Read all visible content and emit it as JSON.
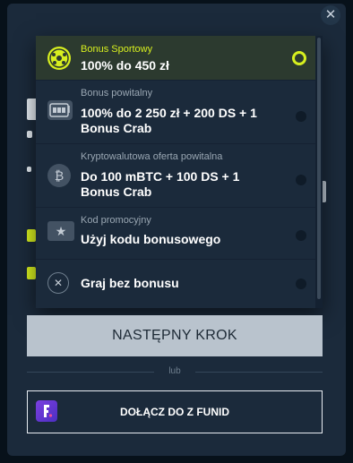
{
  "modal": {
    "close_icon": "close-icon",
    "options": [
      {
        "subtitle": "Bonus Sportowy",
        "title": "100% do 450 zł",
        "icon": "football-icon",
        "selected": true
      },
      {
        "subtitle": "Bonus powitalny",
        "title": "100% do 2 250 zł + 200 DS + 1 Bonus Crab",
        "icon": "slot-machine-icon",
        "selected": false
      },
      {
        "subtitle": "Kryptowalutowa oferta powitalna",
        "title": "Do 100 mBTC + 100 DS + 1 Bonus Crab",
        "icon": "bitcoin-icon",
        "selected": false
      },
      {
        "subtitle": "Kod promocyjny",
        "title": "Użyj kodu bonusowego",
        "icon": "ticket-star-icon",
        "selected": false
      },
      {
        "subtitle": "",
        "title": "Graj bez bonusu",
        "icon": "no-bonus-icon",
        "selected": false
      }
    ],
    "next_button": "NASTĘPNY KROK",
    "divider_text": "lub",
    "funid_button": "DOŁĄCZ DO Z FUNID"
  },
  "colors": {
    "accent": "#d7ef1f",
    "background": "#1b2a3b",
    "button": "#b9c3cd"
  }
}
